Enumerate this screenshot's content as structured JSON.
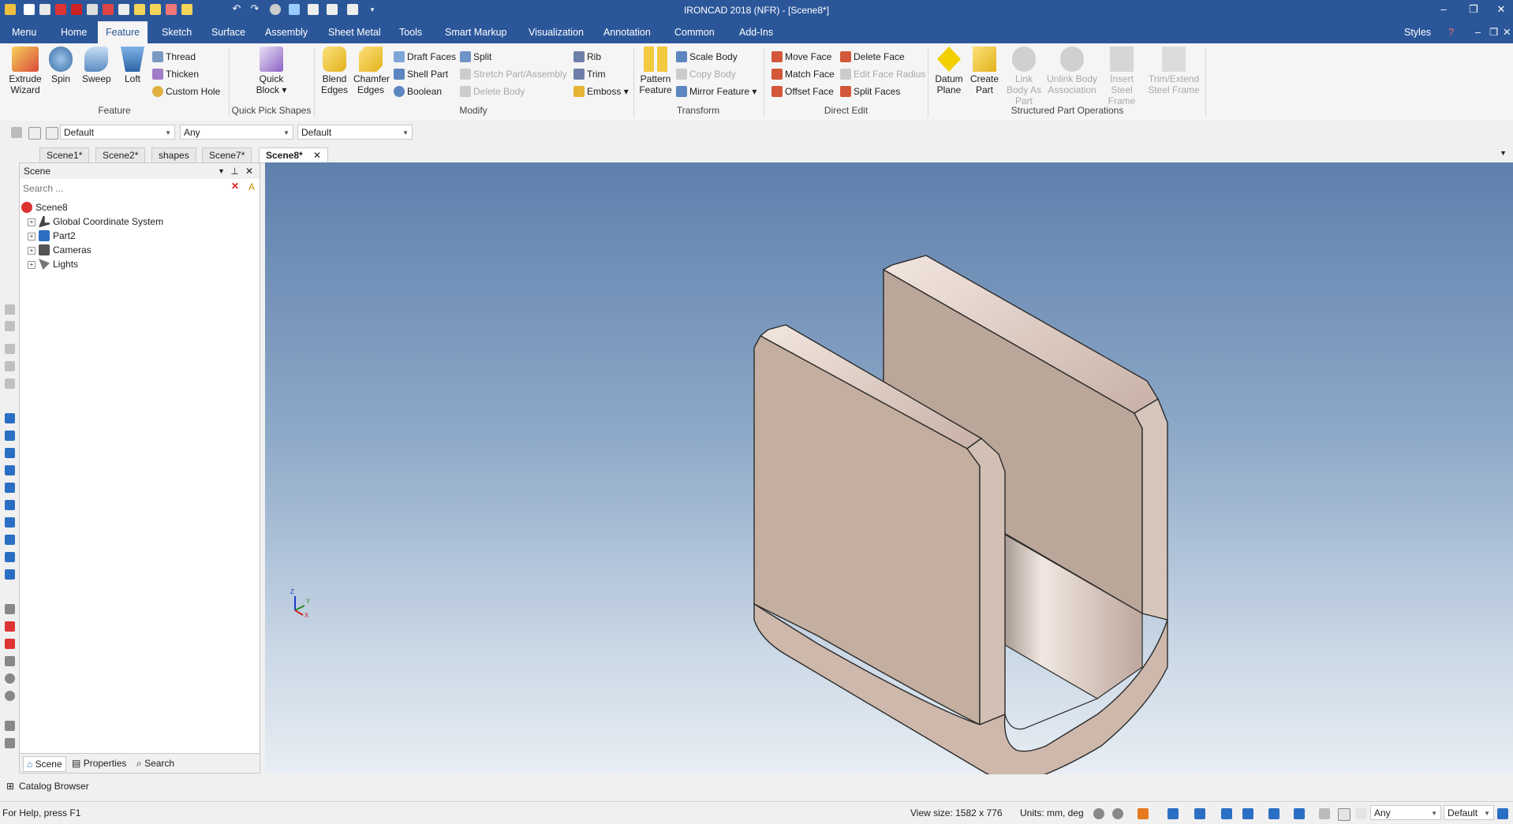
{
  "app": {
    "title": "IRONCAD 2018 (NFR) - [Scene8*]",
    "window_controls": [
      "–",
      "❐",
      "✕"
    ]
  },
  "menu_tabs": [
    "Menu",
    "Home",
    "Feature",
    "Sketch",
    "Surface",
    "Assembly",
    "Sheet Metal",
    "Tools",
    "Smart Markup",
    "Visualization",
    "Annotation",
    "Common",
    "Add-Ins"
  ],
  "active_tab": "Feature",
  "right_menu": {
    "styles": "Styles"
  },
  "ribbon": {
    "feature_group": {
      "label": "Feature",
      "extrude": "Extrude Wizard",
      "spin": "Spin",
      "sweep": "Sweep",
      "loft": "Loft",
      "thread": "Thread",
      "thicken": "Thicken",
      "custom_hole": "Custom Hole"
    },
    "quick_pick": {
      "label": "Quick Pick Shapes",
      "quick_block": "Quick Block"
    },
    "modify": {
      "label": "Modify",
      "blend_edges": "Blend Edges",
      "chamfer_edges": "Chamfer Edges",
      "draft_faces": "Draft Faces",
      "shell_part": "Shell Part",
      "boolean": "Boolean",
      "split": "Split",
      "stretch": "Stretch Part/Assembly",
      "delete_body": "Delete Body",
      "rib": "Rib",
      "trim": "Trim",
      "emboss": "Emboss"
    },
    "transform": {
      "label": "Transform",
      "pattern_feature": "Pattern Feature",
      "scale_body": "Scale Body",
      "copy_body": "Copy Body",
      "mirror_feature": "Mirror Feature"
    },
    "direct_edit": {
      "label": "Direct Edit",
      "move_face": "Move Face",
      "match_face": "Match Face",
      "offset_face": "Offset Face",
      "delete_face": "Delete Face",
      "edit_face_radius": "Edit Face Radius",
      "split_faces": "Split Faces"
    },
    "structured": {
      "label": "Structured Part Operations",
      "datum_plane": "Datum Plane",
      "create_part": "Create Part",
      "link_body": "Link Body As Part",
      "unlink_body": "Unlink Body Association",
      "insert_steel": "Insert Steel Frame",
      "trim_extend": "Trim/Extend Steel Frame"
    }
  },
  "selectors": {
    "style": "Default",
    "filter": "Any",
    "material": "Default"
  },
  "doc_tabs": [
    "Scene1*",
    "Scene2*",
    "shapes",
    "Scene7*",
    "Scene8*"
  ],
  "active_doc": "Scene8*",
  "scene_panel": {
    "title": "Scene",
    "search_placeholder": "Search ...",
    "root": "Scene8",
    "items": [
      "Global Coordinate System",
      "Part2",
      "Cameras",
      "Lights"
    ],
    "bottom_tabs": [
      "Scene",
      "Properties",
      "Search"
    ]
  },
  "axes": {
    "z": "Z",
    "y": "Y",
    "x": "X"
  },
  "catalog": "Catalog Browser",
  "status": {
    "help": "For Help, press F1",
    "view_size": "View size: 1582 x  776",
    "units": "Units: mm, deg",
    "filter": "Any",
    "style": "Default"
  },
  "colors": {
    "accent": "#2b579a",
    "viewport_top": "#5f80ad",
    "viewport_bottom": "#e8eef4",
    "part": "#c9b8ae"
  }
}
